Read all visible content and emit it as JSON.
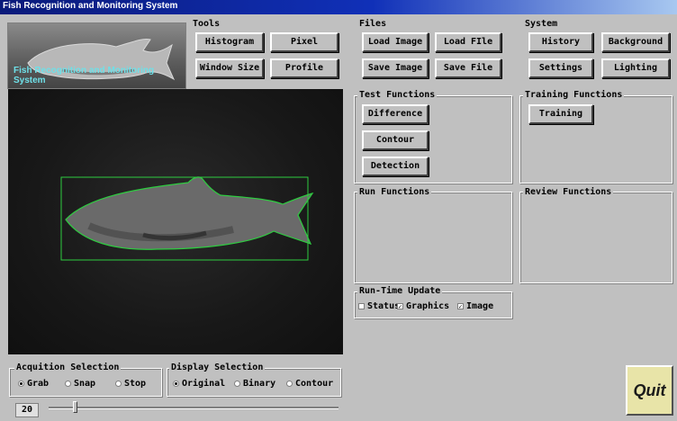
{
  "window": {
    "title": "Fish Recognition and Monitoring System"
  },
  "logo": {
    "caption": "Fish Recognition and Monitoring System"
  },
  "tools": {
    "title": "Tools",
    "histogram": "Histogram",
    "pixel": "Pixel",
    "window_size": "Window Size",
    "profile": "Profile"
  },
  "files": {
    "title": "Files",
    "load_image": "Load Image",
    "load_file": "Load FIle",
    "save_image": "Save Image",
    "save_file": "Save File"
  },
  "system": {
    "title": "System",
    "history": "History",
    "background": "Background",
    "settings": "Settings",
    "lighting": "Lighting"
  },
  "test_functions": {
    "title": "Test Functions",
    "difference": "Difference",
    "contour": "Contour",
    "detection": "Detection"
  },
  "training_functions": {
    "title": "Training Functions",
    "training": "Training"
  },
  "run_functions": {
    "title": "Run Functions"
  },
  "review_functions": {
    "title": "Review Functions"
  },
  "runtime_update": {
    "title": "Run-Time Update",
    "options": [
      {
        "label": "Status",
        "checked": false
      },
      {
        "label": "Graphics",
        "checked": true
      },
      {
        "label": "Image",
        "checked": true
      }
    ]
  },
  "acquisition": {
    "title": "Acquition Selection",
    "options": [
      {
        "label": "Grab",
        "selected": true
      },
      {
        "label": "Snap",
        "selected": false
      },
      {
        "label": "Stop",
        "selected": false
      }
    ]
  },
  "display": {
    "title": "Display Selection",
    "options": [
      {
        "label": "Original",
        "selected": true
      },
      {
        "label": "Binary",
        "selected": false
      },
      {
        "label": "Contour",
        "selected": false
      }
    ]
  },
  "slider": {
    "value": "20"
  },
  "quit": {
    "label": "Quit"
  },
  "colors": {
    "contour": "#2ecc40",
    "title_bar": "#1030b8",
    "quit_bg": "#e8e4a8",
    "logo_text": "#6ee0e8"
  }
}
